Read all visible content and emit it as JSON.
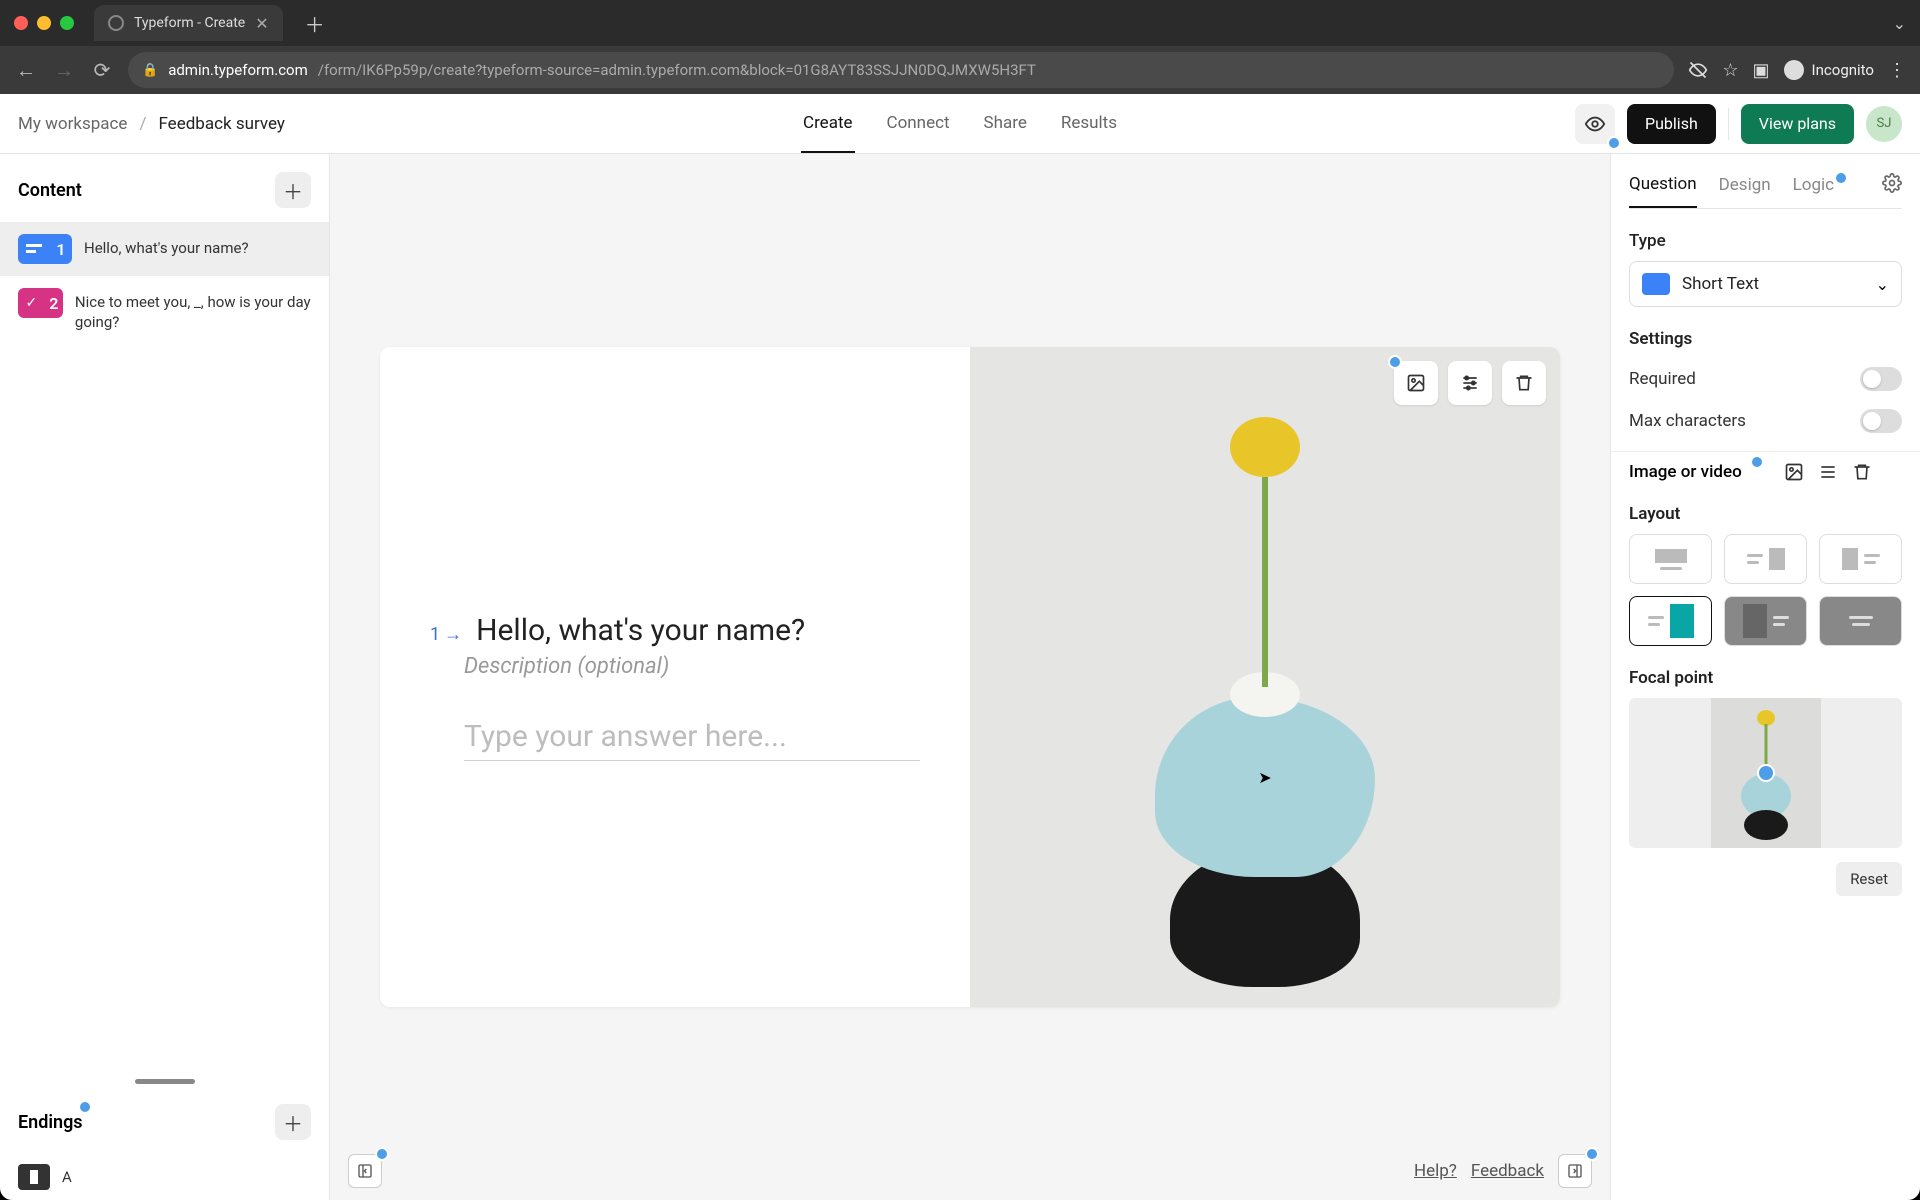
{
  "browser": {
    "tab_title": "Typeform - Create",
    "url_secure": "admin.typeform.com",
    "url_rest": "/form/IK6Pp59p/create?typeform-source=admin.typeform.com&block=01G8AYT83SSJJN0DQJMXW5H3FT",
    "incognito_label": "Incognito"
  },
  "breadcrumb": {
    "workspace": "My workspace",
    "sep": "/",
    "current": "Feedback survey"
  },
  "top_tabs": [
    "Create",
    "Connect",
    "Share",
    "Results"
  ],
  "actions": {
    "publish": "Publish",
    "view_plans": "View plans",
    "avatar": "SJ"
  },
  "left": {
    "content_title": "Content",
    "questions": [
      {
        "num": "1",
        "text": "Hello, what's your name?"
      },
      {
        "num": "2",
        "text": "Nice to meet you, _, how is your day going?"
      }
    ],
    "endings_title": "Endings",
    "ending_label": "A"
  },
  "canvas": {
    "q_num": "1",
    "q_arrow": "→",
    "q_title": "Hello, what's your name?",
    "q_desc": "Description (optional)",
    "answer_placeholder": "Type your answer here...",
    "help": "Help?",
    "feedback": "Feedback"
  },
  "right": {
    "tabs": [
      "Question",
      "Design",
      "Logic"
    ],
    "type_label": "Type",
    "type_value": "Short Text",
    "settings_label": "Settings",
    "setting_required": "Required",
    "setting_max": "Max characters",
    "image_video": "Image or video",
    "layout_label": "Layout",
    "focal_label": "Focal point",
    "reset": "Reset"
  }
}
